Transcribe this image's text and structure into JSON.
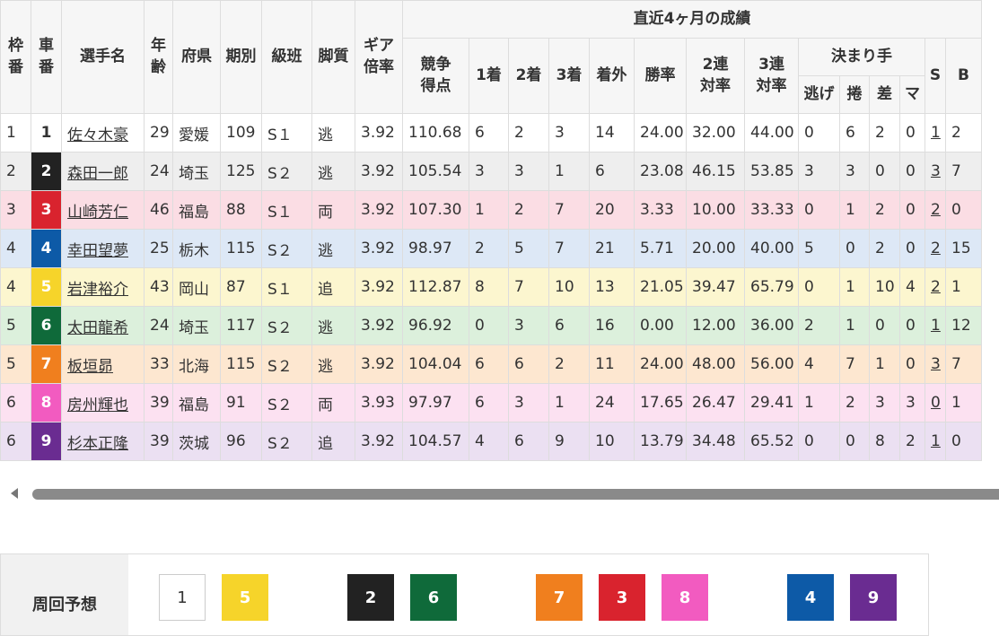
{
  "headers": {
    "waku": "枠番",
    "sha": "車番",
    "name": "選手名",
    "age": "年齢",
    "pref": "府県",
    "term": "期別",
    "class": "級班",
    "leg": "脚質",
    "gear": "ギア倍率",
    "recent": "直近4ヶ月の成績",
    "score": "競争得点",
    "first": "1着",
    "second": "2着",
    "third": "3着",
    "out": "着外",
    "win": "勝率",
    "ren2": "2連対率",
    "ren3": "3連対率",
    "kimarite": "決まり手",
    "nige": "逃げ",
    "makuri": "捲",
    "sashi": "差",
    "ma": "マ",
    "s": "S",
    "b": "B"
  },
  "rows": [
    {
      "waku": "1",
      "car": "1",
      "name": "佐々木豪",
      "age": "29",
      "pref": "愛媛",
      "term": "109",
      "cls": "S１",
      "leg": "逃",
      "gear": "3.92",
      "score": "110.68",
      "f1": "6",
      "f2": "2",
      "f3": "3",
      "fo": "14",
      "win": "24.00",
      "r2": "32.00",
      "r3": "44.00",
      "nige": "0",
      "makuri": "6",
      "sashi": "2",
      "ma": "0",
      "s": "1",
      "b": "2"
    },
    {
      "waku": "2",
      "car": "2",
      "name": "森田一郎",
      "age": "24",
      "pref": "埼玉",
      "term": "125",
      "cls": "S２",
      "leg": "逃",
      "gear": "3.92",
      "score": "105.54",
      "f1": "3",
      "f2": "3",
      "f3": "1",
      "fo": "6",
      "win": "23.08",
      "r2": "46.15",
      "r3": "53.85",
      "nige": "3",
      "makuri": "3",
      "sashi": "0",
      "ma": "0",
      "s": "3",
      "b": "7"
    },
    {
      "waku": "3",
      "car": "3",
      "name": "山崎芳仁",
      "age": "46",
      "pref": "福島",
      "term": "88",
      "cls": "S１",
      "leg": "両",
      "gear": "3.92",
      "score": "107.30",
      "f1": "1",
      "f2": "2",
      "f3": "7",
      "fo": "20",
      "win": "3.33",
      "r2": "10.00",
      "r3": "33.33",
      "nige": "0",
      "makuri": "1",
      "sashi": "2",
      "ma": "0",
      "s": "2",
      "b": "0"
    },
    {
      "waku": "4",
      "car": "4",
      "name": "幸田望夢",
      "age": "25",
      "pref": "栃木",
      "term": "115",
      "cls": "S２",
      "leg": "逃",
      "gear": "3.92",
      "score": "98.97",
      "f1": "2",
      "f2": "5",
      "f3": "7",
      "fo": "21",
      "win": "5.71",
      "r2": "20.00",
      "r3": "40.00",
      "nige": "5",
      "makuri": "0",
      "sashi": "2",
      "ma": "0",
      "s": "2",
      "b": "15"
    },
    {
      "waku": "4",
      "car": "5",
      "name": "岩津裕介",
      "age": "43",
      "pref": "岡山",
      "term": "87",
      "cls": "S１",
      "leg": "追",
      "gear": "3.92",
      "score": "112.87",
      "f1": "8",
      "f2": "7",
      "f3": "10",
      "fo": "13",
      "win": "21.05",
      "r2": "39.47",
      "r3": "65.79",
      "nige": "0",
      "makuri": "1",
      "sashi": "10",
      "ma": "4",
      "s": "2",
      "b": "1"
    },
    {
      "waku": "5",
      "car": "6",
      "name": "太田龍希",
      "age": "24",
      "pref": "埼玉",
      "term": "117",
      "cls": "S２",
      "leg": "逃",
      "gear": "3.92",
      "score": "96.92",
      "f1": "0",
      "f2": "3",
      "f3": "6",
      "fo": "16",
      "win": "0.00",
      "r2": "12.00",
      "r3": "36.00",
      "nige": "2",
      "makuri": "1",
      "sashi": "0",
      "ma": "0",
      "s": "1",
      "b": "12"
    },
    {
      "waku": "5",
      "car": "7",
      "name": "板垣昴",
      "age": "33",
      "pref": "北海",
      "term": "115",
      "cls": "S２",
      "leg": "逃",
      "gear": "3.92",
      "score": "104.04",
      "f1": "6",
      "f2": "6",
      "f3": "2",
      "fo": "11",
      "win": "24.00",
      "r2": "48.00",
      "r3": "56.00",
      "nige": "4",
      "makuri": "7",
      "sashi": "1",
      "ma": "0",
      "s": "3",
      "b": "7"
    },
    {
      "waku": "6",
      "car": "8",
      "name": "房州輝也",
      "age": "39",
      "pref": "福島",
      "term": "91",
      "cls": "S２",
      "leg": "両",
      "gear": "3.93",
      "score": "97.97",
      "f1": "6",
      "f2": "3",
      "f3": "1",
      "fo": "24",
      "win": "17.65",
      "r2": "26.47",
      "r3": "29.41",
      "nige": "1",
      "makuri": "2",
      "sashi": "3",
      "ma": "3",
      "s": "0",
      "b": "1"
    },
    {
      "waku": "6",
      "car": "9",
      "name": "杉本正隆",
      "age": "39",
      "pref": "茨城",
      "term": "96",
      "cls": "S２",
      "leg": "追",
      "gear": "3.92",
      "score": "104.57",
      "f1": "4",
      "f2": "6",
      "f3": "9",
      "fo": "10",
      "win": "13.79",
      "r2": "34.48",
      "r3": "65.52",
      "nige": "0",
      "makuri": "0",
      "sashi": "8",
      "ma": "2",
      "s": "1",
      "b": "0"
    }
  ],
  "prediction": {
    "label": "周回予想",
    "chips": [
      "1",
      "5",
      "2",
      "6",
      "7",
      "3",
      "8",
      "4",
      "9"
    ]
  },
  "colors": {
    "car1": "#ffffff",
    "car2": "#222222",
    "car3": "#d9232e",
    "car4": "#0d5aa7",
    "car5": "#f6d42a",
    "car6": "#0f6a3a",
    "car7": "#f07f1e",
    "car8": "#f25bc0",
    "car9": "#6a2c91"
  }
}
